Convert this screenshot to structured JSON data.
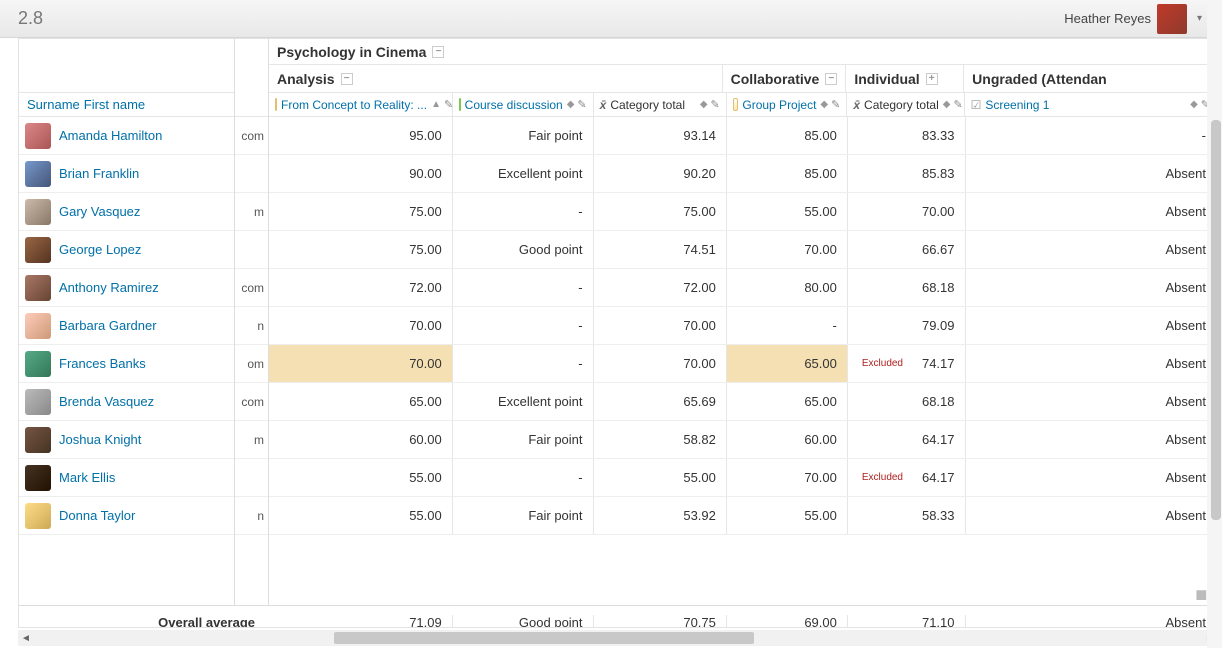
{
  "topbar": {
    "version": "2.8",
    "username": "Heather Reyes"
  },
  "left_header": {
    "surname_link": "Surname",
    "firstname_link": "First name"
  },
  "categories": {
    "root": "Psychology in Cinema",
    "analysis": "Analysis",
    "collaborative": "Collaborative",
    "individual": "Individual",
    "ungraded": "Ungraded (Attendan"
  },
  "columns": {
    "concept": "From Concept to Reality: ...",
    "discussion": "Course discussion",
    "cat_total_a": "Category total",
    "group_project": "Group Project",
    "cat_total_c": "Category total",
    "screening": "Screening 1"
  },
  "students": [
    {
      "name": "Amanda Hamilton",
      "email": "com",
      "concept": "95.00",
      "discussion": "Fair point",
      "cat_a": "93.14",
      "group": "85.00",
      "cat_c": "83.33",
      "screening": "-"
    },
    {
      "name": "Brian Franklin",
      "email": "",
      "concept": "90.00",
      "discussion": "Excellent point",
      "cat_a": "90.20",
      "group": "85.00",
      "cat_c": "85.83",
      "screening": "Absent"
    },
    {
      "name": "Gary Vasquez",
      "email": "m",
      "concept": "75.00",
      "discussion": "-",
      "cat_a": "75.00",
      "group": "55.00",
      "cat_c": "70.00",
      "screening": "Absent"
    },
    {
      "name": "George Lopez",
      "email": "",
      "concept": "75.00",
      "discussion": "Good point",
      "cat_a": "74.51",
      "group": "70.00",
      "cat_c": "66.67",
      "screening": "Absent"
    },
    {
      "name": "Anthony Ramirez",
      "email": "com",
      "concept": "72.00",
      "discussion": "-",
      "cat_a": "72.00",
      "group": "80.00",
      "cat_c": "68.18",
      "screening": "Absent"
    },
    {
      "name": "Barbara Gardner",
      "email": "n",
      "concept": "70.00",
      "discussion": "-",
      "cat_a": "70.00",
      "group": "-",
      "cat_c": "79.09",
      "screening": "Absent"
    },
    {
      "name": "Frances Banks",
      "email": "om",
      "concept": "70.00",
      "discussion": "-",
      "cat_a": "70.00",
      "group": "65.00",
      "cat_c": "74.17",
      "screening": "Absent",
      "excluded_c": true,
      "hl_concept": true,
      "hl_group": true
    },
    {
      "name": "Brenda Vasquez",
      "email": "com",
      "concept": "65.00",
      "discussion": "Excellent point",
      "cat_a": "65.69",
      "group": "65.00",
      "cat_c": "68.18",
      "screening": "Absent"
    },
    {
      "name": "Joshua Knight",
      "email": "m",
      "concept": "60.00",
      "discussion": "Fair point",
      "cat_a": "58.82",
      "group": "60.00",
      "cat_c": "64.17",
      "screening": "Absent"
    },
    {
      "name": "Mark Ellis",
      "email": "",
      "concept": "55.00",
      "discussion": "-",
      "cat_a": "55.00",
      "group": "70.00",
      "cat_c": "64.17",
      "screening": "Absent",
      "excluded_c": true
    },
    {
      "name": "Donna Taylor",
      "email": "n",
      "concept": "55.00",
      "discussion": "Fair point",
      "cat_a": "53.92",
      "group": "55.00",
      "cat_c": "58.33",
      "screening": "Absent"
    }
  ],
  "footer": {
    "label": "Overall average",
    "concept": "71.09",
    "discussion": "Good point",
    "cat_a": "70.75",
    "group": "69.00",
    "cat_c": "71.10",
    "screening": "Absent"
  },
  "excluded_label": "Excluded"
}
